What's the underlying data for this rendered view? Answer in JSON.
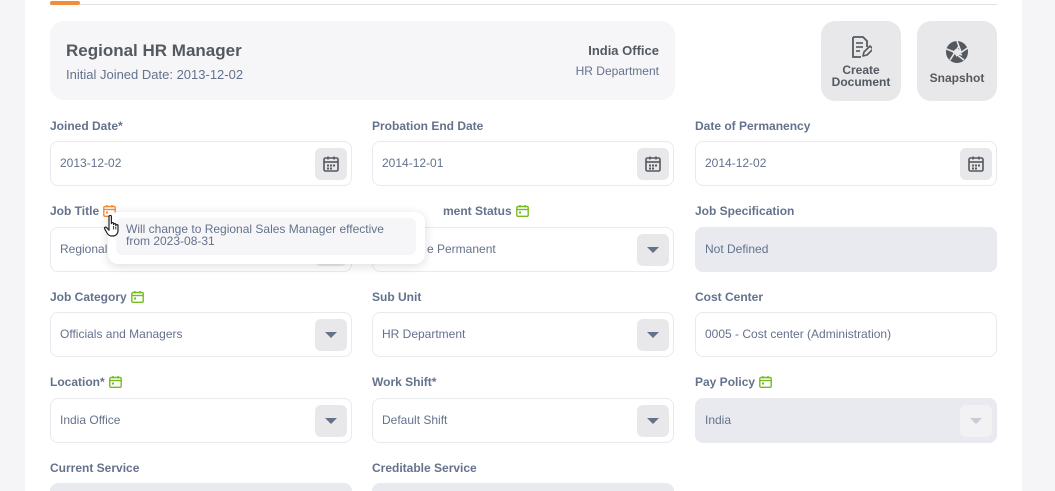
{
  "colors": {
    "accent": "#f28c38",
    "change_icon": "#76bc21",
    "pending_icon": "#f28c38",
    "text": "#64728c",
    "heading": "#54595f",
    "disabled_bg": "#e8eaef"
  },
  "header": {
    "name": "Regional HR Manager",
    "joined": "Initial Joined Date: 2013-12-02",
    "location": "India Office",
    "department": "HR Department"
  },
  "actions": {
    "create_document": [
      "Create",
      "Document"
    ],
    "snapshot": "Snapshot"
  },
  "fields": {
    "joined_date": {
      "label": "Joined Date*",
      "value": "2013-12-02",
      "icon": "calendar-icon"
    },
    "probation_end_date": {
      "label": "Probation End Date",
      "value": "2014-12-01",
      "icon": "calendar-icon"
    },
    "date_of_permanency": {
      "label": "Date of Permanency",
      "value": "2014-12-02",
      "icon": "calendar-icon"
    },
    "job_title": {
      "label": "Job Title",
      "value": "Regional HR Manager",
      "visible_value": "Regional",
      "label_icon": "pending-change-calendar-icon"
    },
    "employment_status": {
      "label": "Employment Status",
      "visible_label": "ment Status",
      "value": "Full Time Permanent",
      "visible_value": "e Permanent",
      "label_icon": "change-calendar-icon"
    },
    "job_specification": {
      "label": "Job Specification",
      "value": "Not Defined",
      "disabled": true
    },
    "job_category": {
      "label": "Job Category",
      "value": "Officials and Managers",
      "label_icon": "change-calendar-icon"
    },
    "sub_unit": {
      "label": "Sub Unit",
      "value": "HR Department"
    },
    "cost_center": {
      "label": "Cost Center",
      "value": "0005 - Cost center (Administration)"
    },
    "location": {
      "label": "Location*",
      "value": "India Office",
      "label_icon": "change-calendar-icon"
    },
    "work_shift": {
      "label": "Work Shift*",
      "value": "Default Shift"
    },
    "pay_policy": {
      "label": "Pay Policy",
      "value": "India",
      "disabled": true,
      "label_icon": "change-calendar-icon"
    },
    "current_service": {
      "label": "Current Service"
    },
    "creditable_service": {
      "label": "Creditable Service"
    }
  },
  "tooltip": {
    "line1": "Will change to Regional Sales Manager effective",
    "line2": "from 2023-08-31"
  }
}
